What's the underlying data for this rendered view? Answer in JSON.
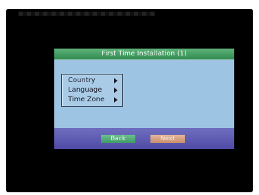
{
  "dialog": {
    "title": "First Time Installation (1)",
    "menu": [
      {
        "label": "Country"
      },
      {
        "label": "Language"
      },
      {
        "label": "Time Zone"
      }
    ],
    "buttons": {
      "back": "Back",
      "next": "Next"
    }
  },
  "colors": {
    "screen": "#000000",
    "title_bar": "#2f8a4f",
    "content": "#9ec4e3",
    "footer": "#4e4aa6",
    "back_button": "#3f9a66",
    "next_button": "#c98f6d"
  }
}
